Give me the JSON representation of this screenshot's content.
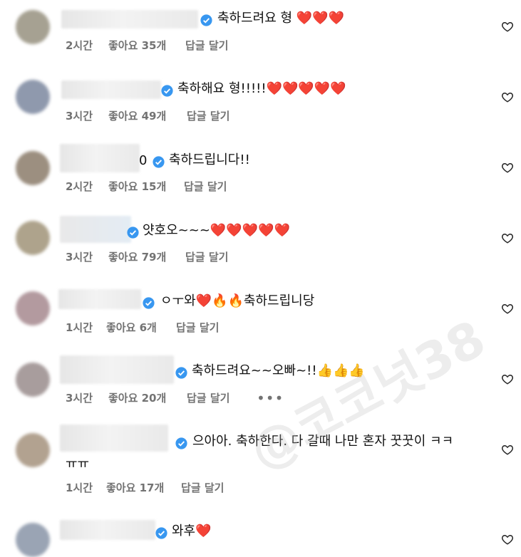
{
  "comments": [
    {
      "text": "축하드려요 형 ❤️❤️❤️",
      "time": "2시간",
      "likes": "좋아요 35개",
      "reply": "답글 달기"
    },
    {
      "text": "축하해요 형!!!!!❤️❤️❤️❤️❤️",
      "time": "3시간",
      "likes": "좋아요 49개",
      "reply": "답글 달기"
    },
    {
      "text": "축하드립니다!!",
      "time": "2시간",
      "likes": "좋아요 15개",
      "reply": "답글 달기",
      "name_tail": "0"
    },
    {
      "text": "얏호오~~~❤️❤️❤️❤️❤️",
      "time": "3시간",
      "likes": "좋아요 79개",
      "reply": "답글 달기"
    },
    {
      "text": "ㅇㅜ와❤️🔥🔥축하드립니당",
      "time": "1시간",
      "likes": "좋아요 6개",
      "reply": "답글 달기"
    },
    {
      "text": "축하드려요~~오빠~!!👍👍👍",
      "time": "3시간",
      "likes": "좋아요 20개",
      "reply": "답글 달기",
      "more": "•••"
    },
    {
      "text": "으아아. 축하한다. 다 갈때 나만 혼자 꿋꿋이 ㅋㅋ",
      "text_line2": "ㅠㅠ",
      "time": "1시간",
      "likes": "좋아요 17개",
      "reply": "답글 달기"
    },
    {
      "text": "와후❤️"
    }
  ],
  "watermark": "@코코넛38",
  "icons": {
    "verified": "verified-badge-icon",
    "like": "heart-outline-icon"
  },
  "colors": {
    "verified": "#3897f0",
    "meta": "#737373"
  }
}
